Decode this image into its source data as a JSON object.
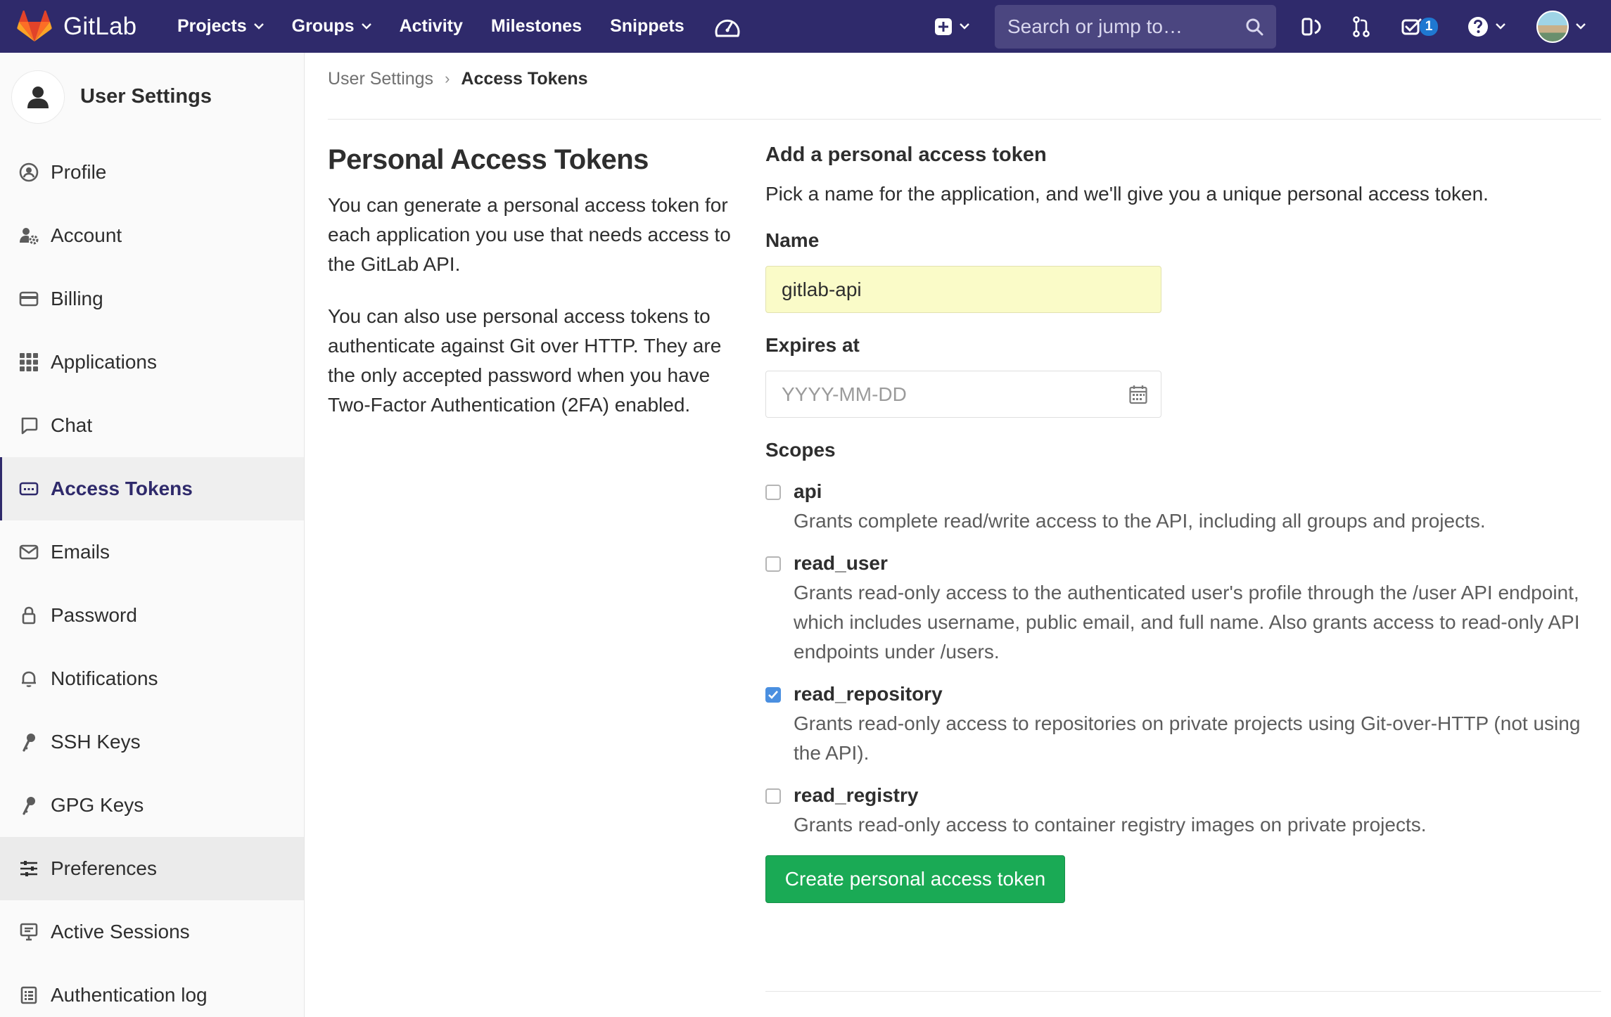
{
  "navbar": {
    "brand": "GitLab",
    "menu": [
      {
        "label": "Projects",
        "dropdown": true
      },
      {
        "label": "Groups",
        "dropdown": true
      },
      {
        "label": "Activity",
        "dropdown": false
      },
      {
        "label": "Milestones",
        "dropdown": false
      },
      {
        "label": "Snippets",
        "dropdown": false
      }
    ],
    "search_placeholder": "Search or jump to…",
    "todo_count": "1",
    "icons": [
      "gauge-icon",
      "plus-square-icon",
      "issues-icon",
      "merge-request-icon",
      "todo-icon",
      "help-icon",
      "avatar"
    ],
    "color": "#2f2a6b"
  },
  "sidebar": {
    "title": "User Settings",
    "items": [
      {
        "label": "Profile",
        "icon": "profile-icon",
        "state": ""
      },
      {
        "label": "Account",
        "icon": "account-gear-icon",
        "state": ""
      },
      {
        "label": "Billing",
        "icon": "credit-card-icon",
        "state": ""
      },
      {
        "label": "Applications",
        "icon": "applications-grid-icon",
        "state": ""
      },
      {
        "label": "Chat",
        "icon": "chat-bubble-icon",
        "state": ""
      },
      {
        "label": "Access Tokens",
        "icon": "token-icon",
        "state": "active"
      },
      {
        "label": "Emails",
        "icon": "envelope-icon",
        "state": ""
      },
      {
        "label": "Password",
        "icon": "lock-icon",
        "state": ""
      },
      {
        "label": "Notifications",
        "icon": "bell-icon",
        "state": ""
      },
      {
        "label": "SSH Keys",
        "icon": "key-icon",
        "state": ""
      },
      {
        "label": "GPG Keys",
        "icon": "key-icon",
        "state": ""
      },
      {
        "label": "Preferences",
        "icon": "sliders-icon",
        "state": "hover"
      },
      {
        "label": "Active Sessions",
        "icon": "monitor-icon",
        "state": ""
      },
      {
        "label": "Authentication log",
        "icon": "log-icon",
        "state": ""
      }
    ]
  },
  "breadcrumb": {
    "parent": "User Settings",
    "current": "Access Tokens"
  },
  "intro": {
    "title": "Personal Access Tokens",
    "paragraph1": "You can generate a personal access token for each application you use that needs access to the GitLab API.",
    "paragraph2": "You can also use personal access tokens to authenticate against Git over HTTP. They are the only accepted password when you have Two-Factor Authentication (2FA) enabled."
  },
  "form": {
    "heading": "Add a personal access token",
    "subheading": "Pick a name for the application, and we'll give you a unique personal access token.",
    "name_label": "Name",
    "name_value": "gitlab-api",
    "expires_label": "Expires at",
    "expires_placeholder": "YYYY-MM-DD",
    "scopes_label": "Scopes",
    "scopes": [
      {
        "name": "api",
        "checked": false,
        "description": "Grants complete read/write access to the API, including all groups and projects."
      },
      {
        "name": "read_user",
        "checked": false,
        "description": "Grants read-only access to the authenticated user's profile through the /user API endpoint, which includes username, public email, and full name. Also grants access to read-only API endpoints under /users."
      },
      {
        "name": "read_repository",
        "checked": true,
        "description": "Grants read-only access to repositories on private projects using Git-over-HTTP (not using the API)."
      },
      {
        "name": "read_registry",
        "checked": false,
        "description": "Grants read-only access to container registry images on private projects."
      }
    ],
    "submit_label": "Create personal access token",
    "button_color": "#1aaa55"
  }
}
